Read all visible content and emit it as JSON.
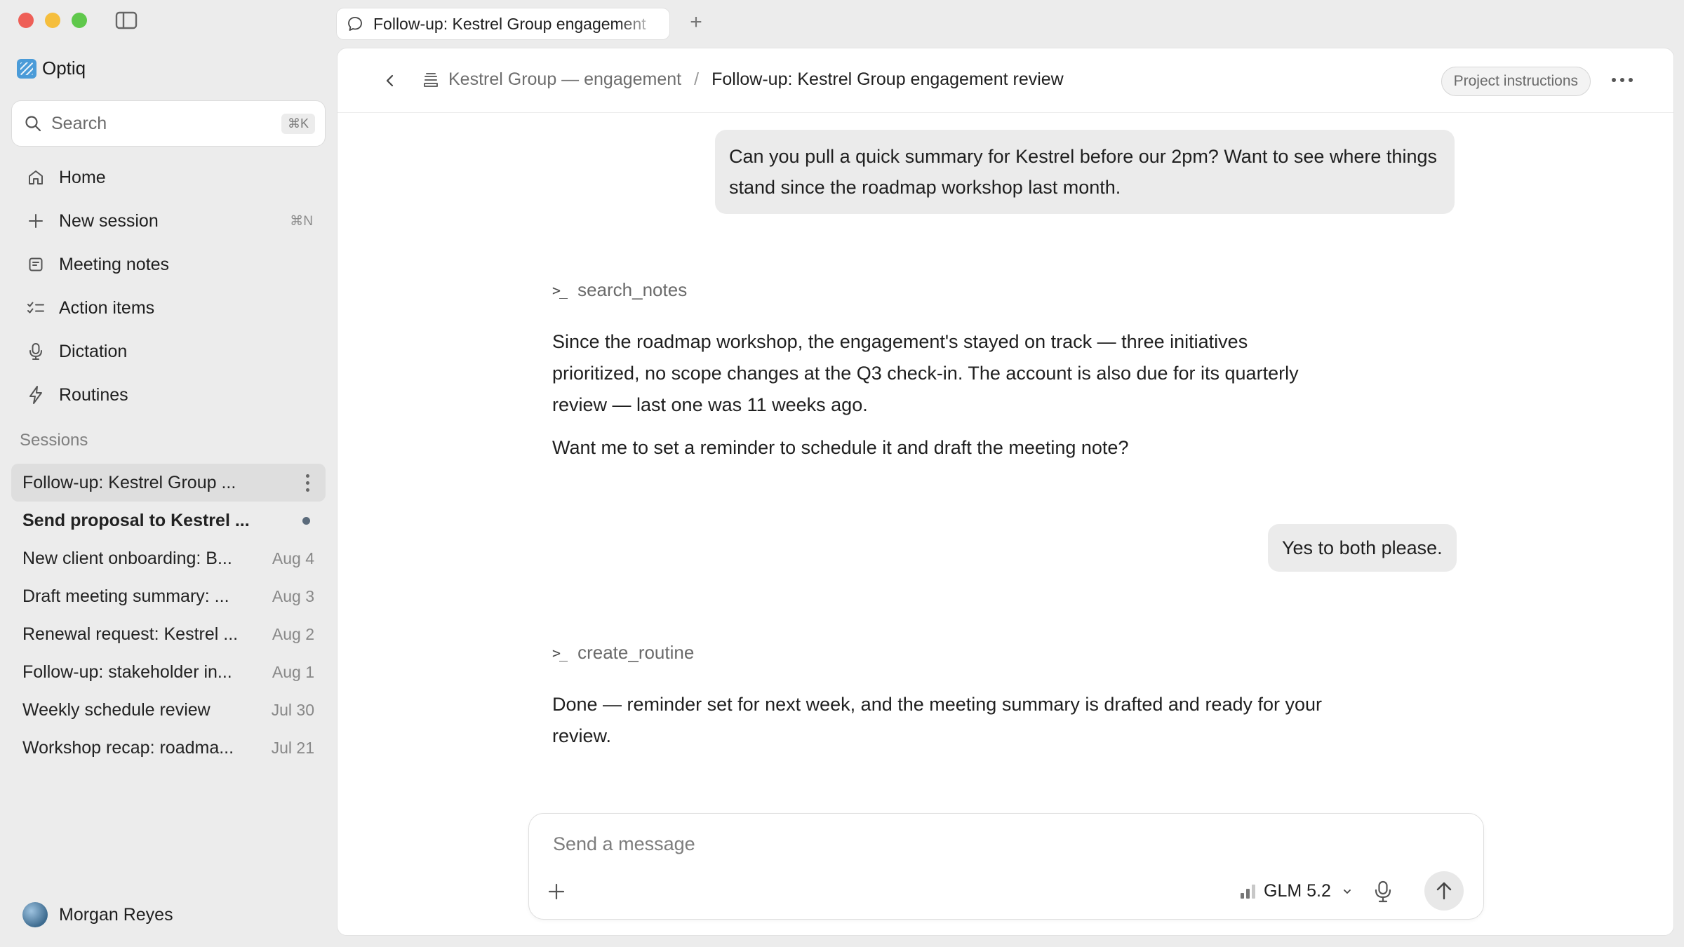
{
  "app": {
    "name": "Optiq"
  },
  "sidebar": {
    "search": {
      "label": "Search",
      "shortcut": "⌘K"
    },
    "nav": [
      {
        "label": "Home",
        "icon": "home-icon",
        "shortcut": ""
      },
      {
        "label": "New session",
        "icon": "plus-icon",
        "shortcut": "⌘N"
      },
      {
        "label": "Meeting notes",
        "icon": "note-icon",
        "shortcut": ""
      },
      {
        "label": "Action items",
        "icon": "checklist-icon",
        "shortcut": ""
      },
      {
        "label": "Dictation",
        "icon": "microphone-icon",
        "shortcut": ""
      },
      {
        "label": "Routines",
        "icon": "lightning-icon",
        "shortcut": ""
      }
    ],
    "sessions_title": "Sessions",
    "sessions": [
      {
        "title": "Follow-up: Kestrel Group ...",
        "date": "",
        "active": true
      },
      {
        "title": "Send proposal to Kestrel ...",
        "date": "",
        "unread": true
      },
      {
        "title": "New client onboarding: B...",
        "date": "Aug 4"
      },
      {
        "title": "Draft meeting summary: ...",
        "date": "Aug 3"
      },
      {
        "title": "Renewal request: Kestrel ...",
        "date": "Aug 2"
      },
      {
        "title": "Follow-up: stakeholder in...",
        "date": "Aug 1"
      },
      {
        "title": "Weekly schedule review",
        "date": "Jul 30"
      },
      {
        "title": "Workshop recap: roadma...",
        "date": "Jul 21"
      }
    ],
    "user": {
      "name": "Morgan Reyes"
    }
  },
  "tab": {
    "label": "Follow-up: Kestrel Group engagement"
  },
  "header": {
    "breadcrumb_parent": "Kestrel Group — engagement",
    "breadcrumb_separator": "/",
    "breadcrumb_current": "Follow-up: Kestrel Group engagement review",
    "project_instructions": "Project instructions"
  },
  "conversation": {
    "user_1": "Can you pull a quick summary for Kestrel before our 2pm? Want to see where things stand since the roadmap workshop last month.",
    "tool_1": "search_notes",
    "assistant_1a": "Since the roadmap workshop, the engagement's stayed on track — three initiatives prioritized, no scope changes at the Q3 check-in. The account is also due for its quarterly review — last one was 11 weeks ago.",
    "assistant_1b": "Want me to set a reminder to schedule it and draft the meeting note?",
    "user_2": "Yes to both please.",
    "tool_2": "create_routine",
    "assistant_2": "Done — reminder set for next week, and the meeting summary is drafted and ready for your review."
  },
  "composer": {
    "placeholder": "Send a message",
    "model": "GLM 5.2"
  }
}
